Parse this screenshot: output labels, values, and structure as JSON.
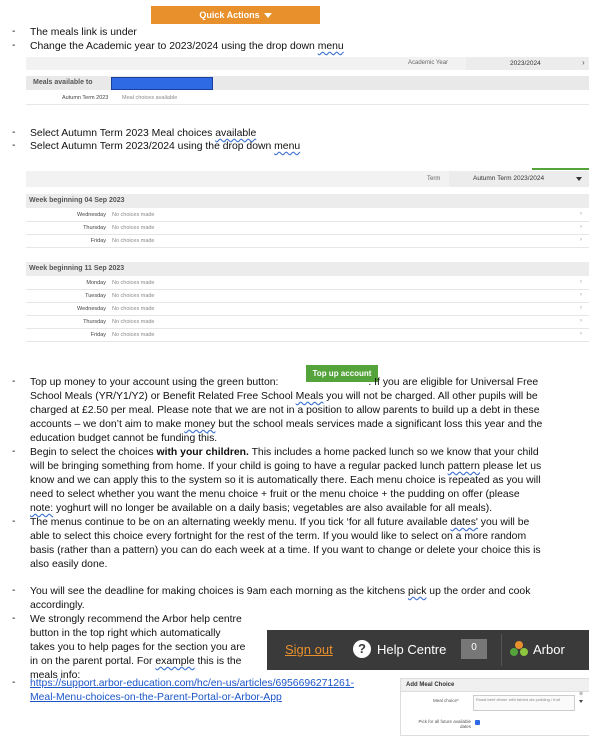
{
  "quick_actions": {
    "label": "Quick Actions"
  },
  "steps_top": [
    {
      "bullet": "-",
      "text": "The meals link is under"
    },
    {
      "bullet": "-",
      "pre": "Change the Academic year to 2023/2024 using the drop down ",
      "link": "menu"
    }
  ],
  "academic_year": {
    "label": "Academic Year",
    "value": "2023/2024",
    "caret": "›"
  },
  "meals_panel": {
    "title": "Meals available to",
    "redacted_color": "#2d6ae3",
    "row_term": "Autumn Term 2023",
    "row_status": "Meal choices available"
  },
  "steps_mid": [
    {
      "bullet": "-",
      "pre": "Select Autumn Term 2023 Meal choices ",
      "link": "available"
    },
    {
      "bullet": "-",
      "pre": "Select Autumn Term 2023/2024 using the drop down ",
      "link": "menu"
    }
  ],
  "term_select": {
    "label": "Term",
    "value": "Autumn Term 2023/2024"
  },
  "weeks": [
    {
      "title": "Week beginning 04 Sep 2023",
      "rows": [
        {
          "day": "Wednesday",
          "status": "No choices made"
        },
        {
          "day": "Thursday",
          "status": "No choices made"
        },
        {
          "day": "Friday",
          "status": "No choices made"
        }
      ]
    },
    {
      "title": "Week beginning 11 Sep 2023",
      "rows": [
        {
          "day": "Monday",
          "status": "No choices made"
        },
        {
          "day": "Tuesday",
          "status": "No choices made"
        },
        {
          "day": "Wednesday",
          "status": "No choices made"
        },
        {
          "day": "Thursday",
          "status": "No choices made"
        },
        {
          "day": "Friday",
          "status": "No choices made"
        }
      ]
    }
  ],
  "top_up": {
    "label": "Top up account"
  },
  "para_topup": {
    "l1": "Top up money to your account using the green button:",
    "l1b": ". If you are eligible for Universal Free",
    "l2a": "School Meals (YR/Y1/Y2) or Benefit Related Free School ",
    "l2link": "Meals",
    "l2b": " you will not be charged.  All other pupils will be",
    "l3": "charged at £2.50 per meal.  Please note that we are not in a position to allow parents to build up a debt in these",
    "l4a": "accounts – we don’t aim to make ",
    "l4link": "money",
    "l4b": " but the school meals services made a significant loss this year and the",
    "l5": "education budget cannot be funding this."
  },
  "para_choices": {
    "l1a": "Begin to select the choices ",
    "l1bold": "with your children.",
    "l1b": "  This includes a home packed lunch so we know that your child",
    "l2a": "will be bringing something from home.  If your child is going to have a regular packed lunch ",
    "l2link": "pattern",
    "l2b": " please let us",
    "l3": "know and we can apply this to the system so it is automatically there.  Each menu choice is repeated as you will",
    "l4": "need to select whether you want the menu choice + fruit or the menu choice + the pudding on offer (please",
    "l5link": "note:",
    "l5b": " yoghurt will no longer be available on a daily basis; vegetables are also available for all meals)."
  },
  "para_menus": {
    "l1a": "The menus continue to be on an alternating weekly menu.  If you tick ‘for all future available ",
    "l1link": "dates'",
    "l1b": " you will be",
    "l2": "able to select this choice every fortnight for the rest of the term.  If you would like to select on a more random",
    "l3": "basis (rather than a pattern) you can do each week at a time. If you want to change or delete your choice this is",
    "l4": "also easily done."
  },
  "para_deadline": {
    "l1a": "You will see the deadline for making choices is 9am each morning as the kitchens ",
    "l1link": "pick",
    "l1b": " up the order and cook",
    "l2": "accordingly."
  },
  "para_help": {
    "l1": "We strongly recommend the Arbor help centre",
    "l2": "button in the top right which automatically",
    "l3": "takes you to help pages for the section you are",
    "l4": "in on the parent portal.  For ",
    "l4link": "example",
    "l4b": " this is the",
    "l5": "meals info:"
  },
  "help_bar": {
    "sign_out": "Sign out",
    "help_centre": "Help Centre",
    "badge": "0",
    "brand": "Arbor"
  },
  "url": {
    "l1": "https://support.arbor-education.com/hc/en-us/articles/6956696271261-",
    "l2": "Meal-Menu-choices-on-the-Parent-Portal-or-Arbor-App"
  },
  "add_meal": {
    "title": "Add Meal Choice",
    "field_label": "Meal choice*",
    "field_value": "Roast beef dinner with fairted ola pudding / fruit",
    "future_label": "Pick for all future available",
    "future_label2": "dates"
  },
  "colors": {
    "orange": "#e8902c",
    "green": "#55a33b",
    "dark": "#3a3a3a",
    "link": "#1b56c8"
  }
}
